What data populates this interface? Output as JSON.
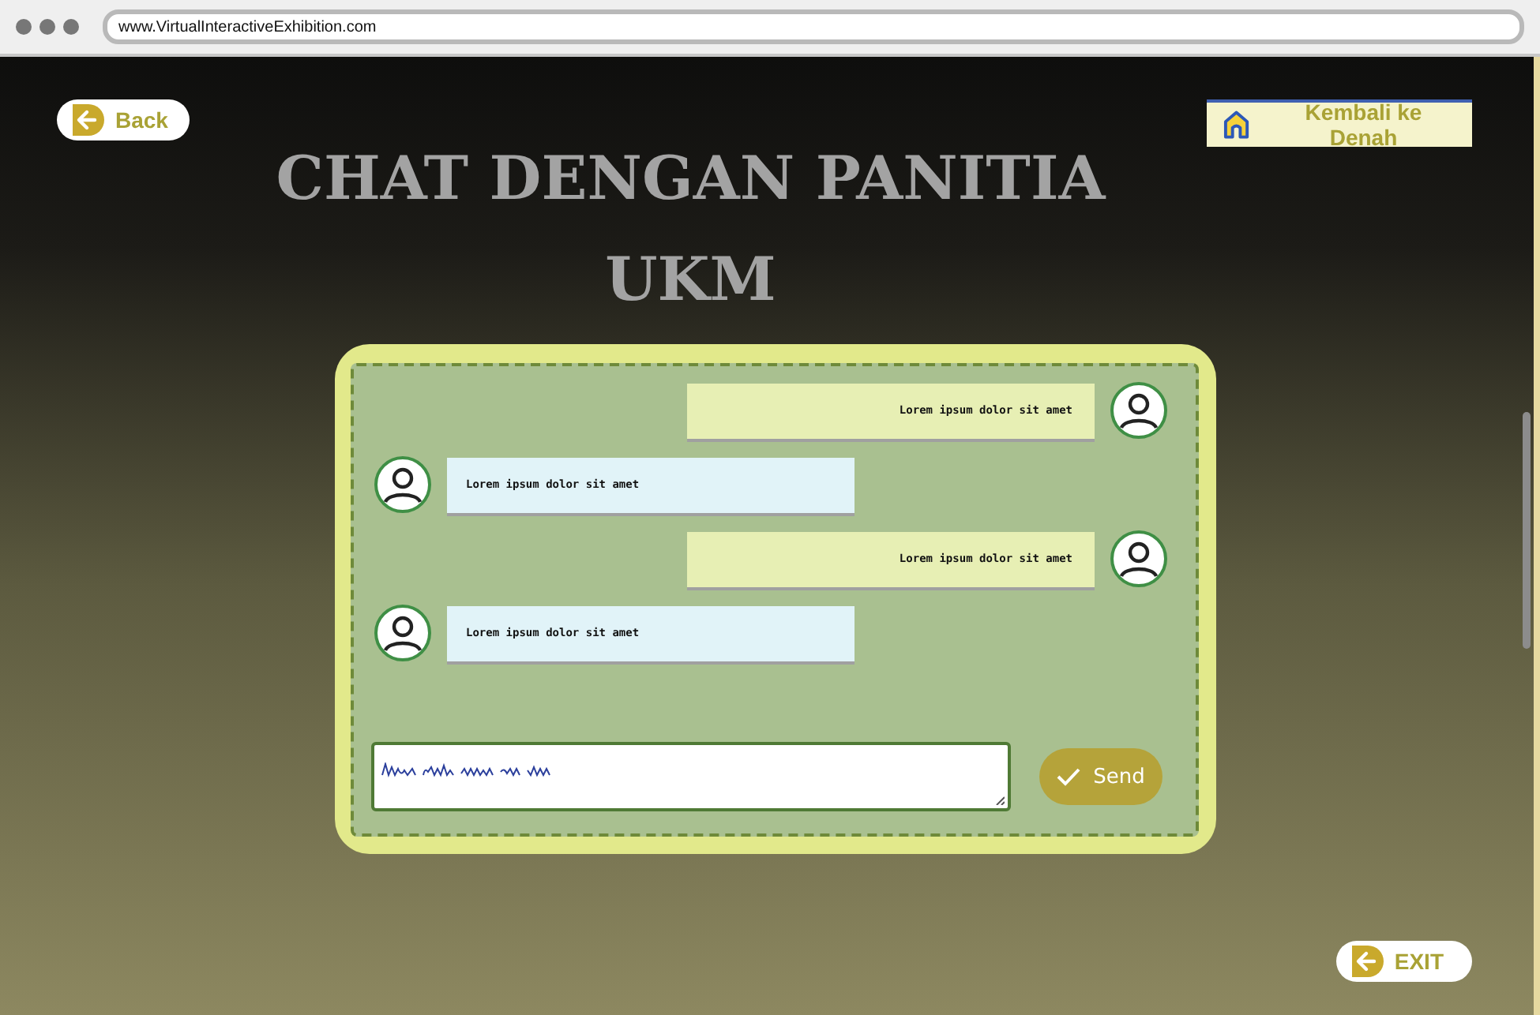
{
  "browser": {
    "url": "www.VirtualInteractiveExhibition.com"
  },
  "back_button": {
    "label": "Back"
  },
  "home_button": {
    "label": "Kembali ke Denah"
  },
  "title": "CHAT DENGAN PANITIA UKM",
  "messages": [
    {
      "kind": "sent",
      "text": "Lorem ipsum dolor sit amet"
    },
    {
      "kind": "received",
      "text": "Lorem ipsum dolor sit amet"
    },
    {
      "kind": "sent",
      "text": "Lorem ipsum dolor sit amet"
    },
    {
      "kind": "received",
      "text": "Lorem ipsum dolor sit amet"
    }
  ],
  "send_button": {
    "label": "Send"
  },
  "exit_button": {
    "label": "EXIT"
  }
}
